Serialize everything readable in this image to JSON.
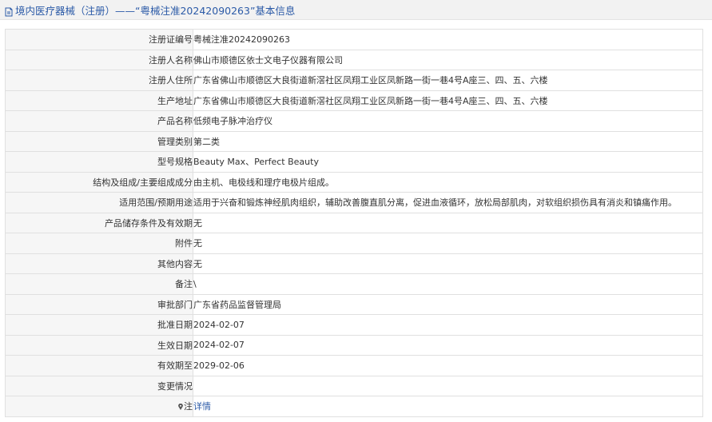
{
  "header": {
    "title": "境内医疗器械（注册）——“粤械注准20242090263”基本信息"
  },
  "rows": [
    {
      "label": "注册证编号",
      "value": "粤械注准20242090263"
    },
    {
      "label": "注册人名称",
      "value": "佛山市顺德区依士文电子仪器有限公司"
    },
    {
      "label": "注册人住所",
      "value": "广东省佛山市顺德区大良街道新滘社区凤翔工业区凤新路一街一巷4号A座三、四、五、六楼"
    },
    {
      "label": "生产地址",
      "value": "广东省佛山市顺德区大良街道新滘社区凤翔工业区凤新路一街一巷4号A座三、四、五、六楼"
    },
    {
      "label": "产品名称",
      "value": "低频电子脉冲治疗仪"
    },
    {
      "label": "管理类别",
      "value": "第二类"
    },
    {
      "label": "型号规格",
      "value": "Beauty Max、Perfect Beauty"
    },
    {
      "label": "结构及组成/主要组成成分",
      "value": "由主机、电极线和理疗电极片组成。"
    },
    {
      "label": "适用范围/预期用途",
      "value": "适用于兴奋和锻炼神经肌肉组织，辅助改善腹直肌分离，促进血液循环，放松局部肌肉，对软组织损伤具有消炎和镇痛作用。"
    },
    {
      "label": "产品储存条件及有效期",
      "value": "无"
    },
    {
      "label": "附件",
      "value": "无"
    },
    {
      "label": "其他内容",
      "value": "无"
    },
    {
      "label": "备注",
      "value": "\\"
    },
    {
      "label": "审批部门",
      "value": "广东省药品监督管理局"
    },
    {
      "label": "批准日期",
      "value": "2024-02-07"
    },
    {
      "label": "生效日期",
      "value": "2024-02-07"
    },
    {
      "label": "有效期至",
      "value": "2029-02-06"
    },
    {
      "label": "变更情况",
      "value": ""
    },
    {
      "label": "注",
      "value": "详情"
    }
  ]
}
